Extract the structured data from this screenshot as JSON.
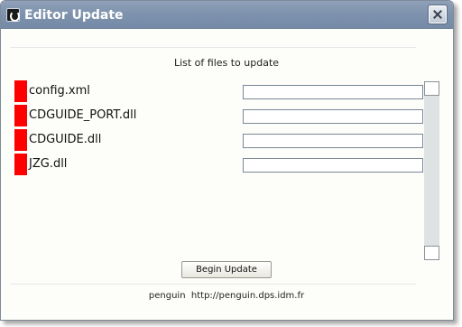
{
  "window": {
    "title": "Editor Update"
  },
  "main": {
    "header": "List of files to update",
    "files": [
      {
        "name": "config.xml",
        "progress": 0
      },
      {
        "name": "CDGUIDE_PORT.dll",
        "progress": 0
      },
      {
        "name": "CDGUIDE.dll",
        "progress": 0
      },
      {
        "name": "JZG.dll",
        "progress": 0
      }
    ],
    "begin_button": "Begin Update"
  },
  "footer": {
    "user": "penguin",
    "url": "http://penguin.dps.idm.fr"
  },
  "colors": {
    "file_marker": "#ff0000",
    "titlebar": "#8fa0b8"
  },
  "icons": {
    "app": "app-icon",
    "close": "close-icon"
  }
}
